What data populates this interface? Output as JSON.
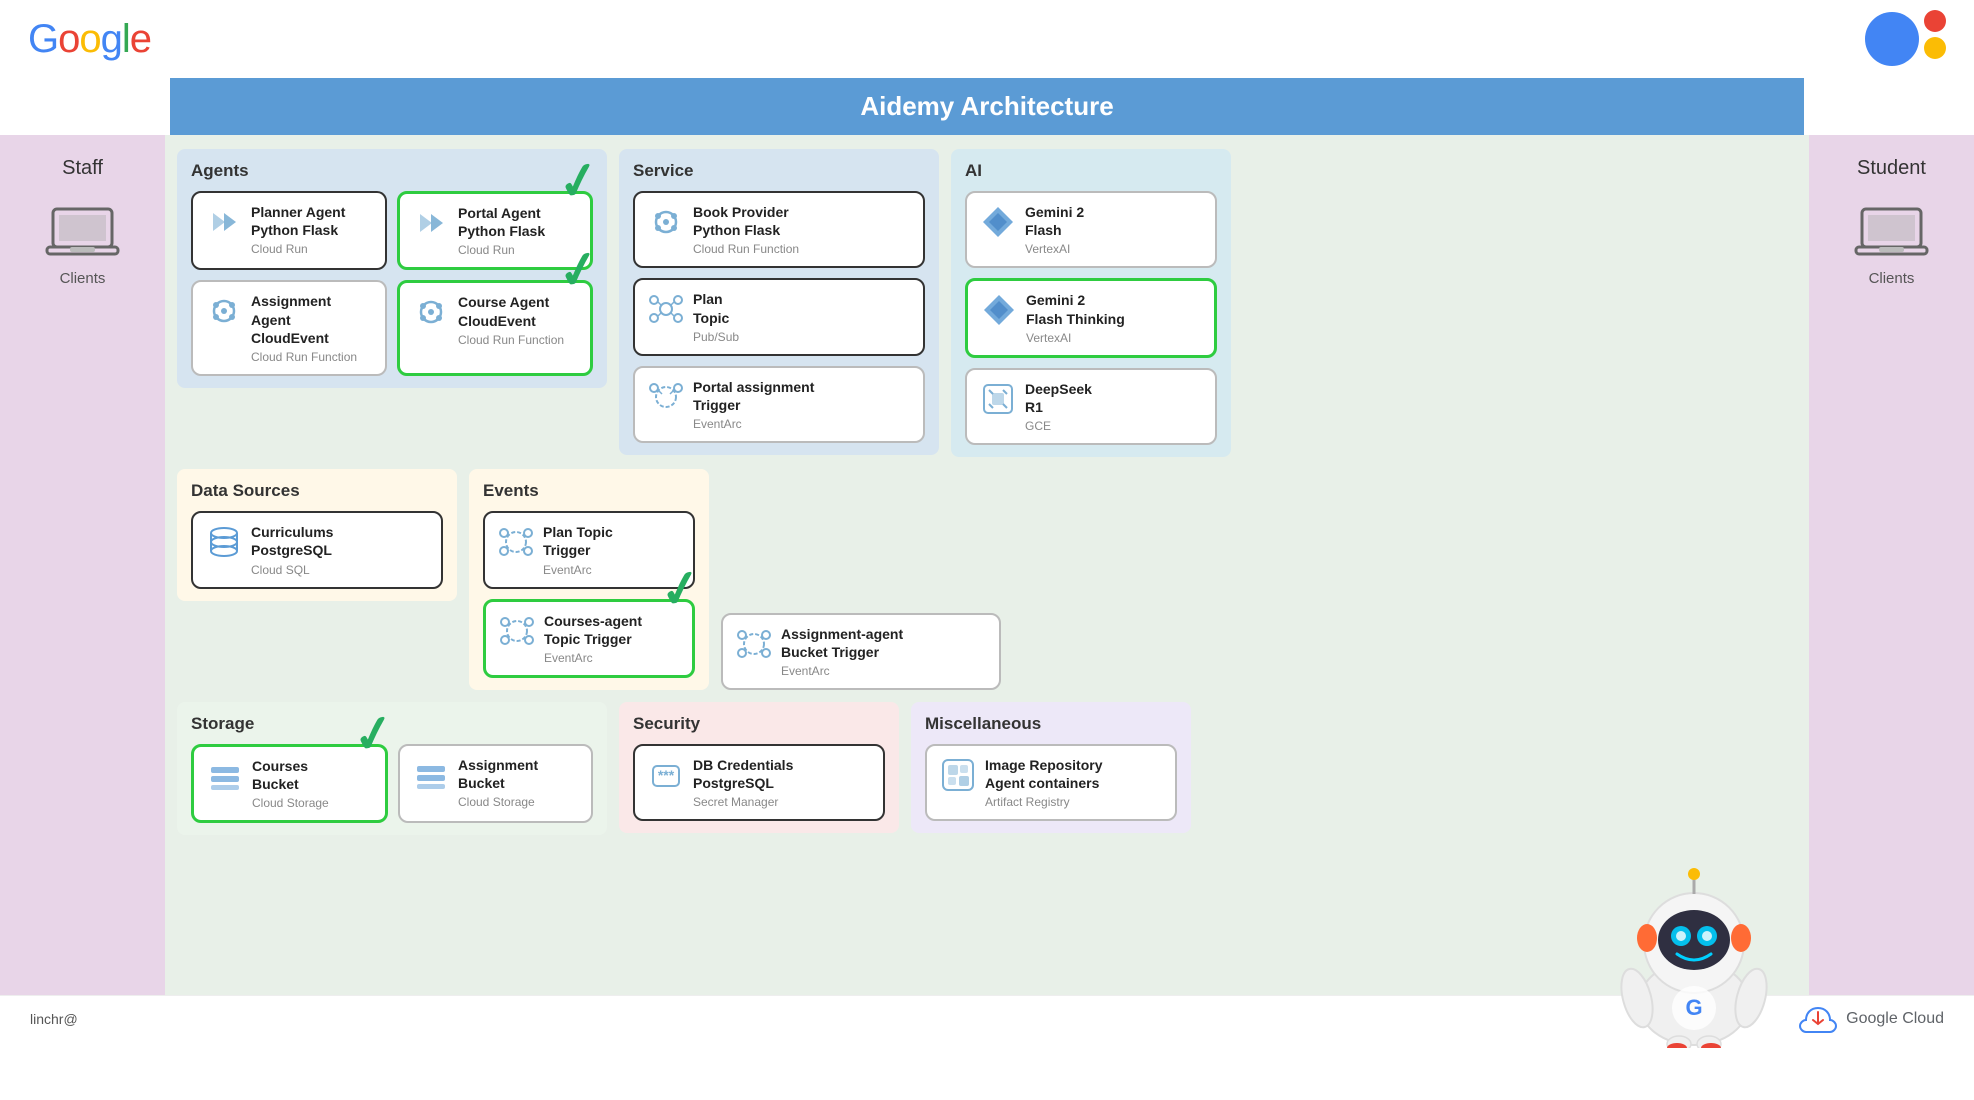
{
  "header": {
    "google_logo": "Google",
    "title": "Aidemy Architecture",
    "footer_email": "linchr@"
  },
  "sidebar_left": {
    "label": "Staff",
    "client_label": "Clients"
  },
  "sidebar_right": {
    "label": "Student",
    "client_label": "Clients"
  },
  "sections": {
    "agents": {
      "label": "Agents",
      "items": [
        {
          "title": "Planner Agent\nPython Flask",
          "sub": "Cloud Run",
          "has_checkmark": false,
          "border": "dark"
        },
        {
          "title": "Portal Agent\nPython Flask",
          "sub": "Cloud Run",
          "has_checkmark": true,
          "border": "green"
        },
        {
          "title": "Assignment Agent\nCloudEvent",
          "sub": "Cloud Run Function",
          "has_checkmark": false,
          "border": "normal"
        },
        {
          "title": "Course Agent\nCloudEvent",
          "sub": "Cloud Run Function",
          "has_checkmark": true,
          "border": "green"
        }
      ]
    },
    "service": {
      "label": "Service",
      "items": [
        {
          "title": "Book Provider\nPython Flask",
          "sub": "Cloud Run Function",
          "has_checkmark": false,
          "border": "dark"
        },
        {
          "title": "Plan\nTopic",
          "sub": "Pub/Sub",
          "has_checkmark": false,
          "border": "dark"
        },
        {
          "title": "Portal assignment\nTrigger",
          "sub": "EventArc",
          "has_checkmark": false,
          "border": "normal"
        }
      ]
    },
    "ai": {
      "label": "AI",
      "items": [
        {
          "title": "Gemini 2\nFlash",
          "sub": "VertexAI",
          "has_checkmark": false,
          "border": "normal"
        },
        {
          "title": "Gemini 2\nFlash Thinking",
          "sub": "VertexAI",
          "has_checkmark": false,
          "border": "green"
        },
        {
          "title": "DeepSeek\nR1",
          "sub": "GCE",
          "has_checkmark": false,
          "border": "normal"
        }
      ]
    },
    "datasources": {
      "label": "Data Sources",
      "items": [
        {
          "title": "Curriculums\nPostgreSQL",
          "sub": "Cloud SQL",
          "has_checkmark": false,
          "border": "dark"
        }
      ]
    },
    "events": {
      "label": "Events",
      "items": [
        {
          "title": "Plan Topic\nTrigger",
          "sub": "EventArc",
          "has_checkmark": false,
          "border": "dark"
        },
        {
          "title": "Courses-agent\nTopic Trigger",
          "sub": "EventArc",
          "has_checkmark": true,
          "border": "green"
        }
      ]
    },
    "triggers_extra": {
      "items": [
        {
          "title": "Assignment-agent\nBucket Trigger",
          "sub": "EventArc",
          "has_checkmark": false,
          "border": "normal"
        }
      ]
    },
    "storage": {
      "label": "Storage",
      "items": [
        {
          "title": "Courses\nBucket",
          "sub": "Cloud Storage",
          "has_checkmark": true,
          "border": "green"
        },
        {
          "title": "Assignment\nBucket",
          "sub": "Cloud Storage",
          "has_checkmark": false,
          "border": "normal"
        }
      ]
    },
    "security": {
      "label": "Security",
      "items": [
        {
          "title": "DB Credentials\nPostgreSQL",
          "sub": "Secret Manager",
          "has_checkmark": false,
          "border": "dark"
        }
      ]
    },
    "misc": {
      "label": "Miscellaneous",
      "items": [
        {
          "title": "Image Repository\nAgent containers",
          "sub": "Artifact Registry",
          "has_checkmark": false,
          "border": "normal"
        }
      ]
    }
  },
  "google_cloud_label": "Google Cloud"
}
